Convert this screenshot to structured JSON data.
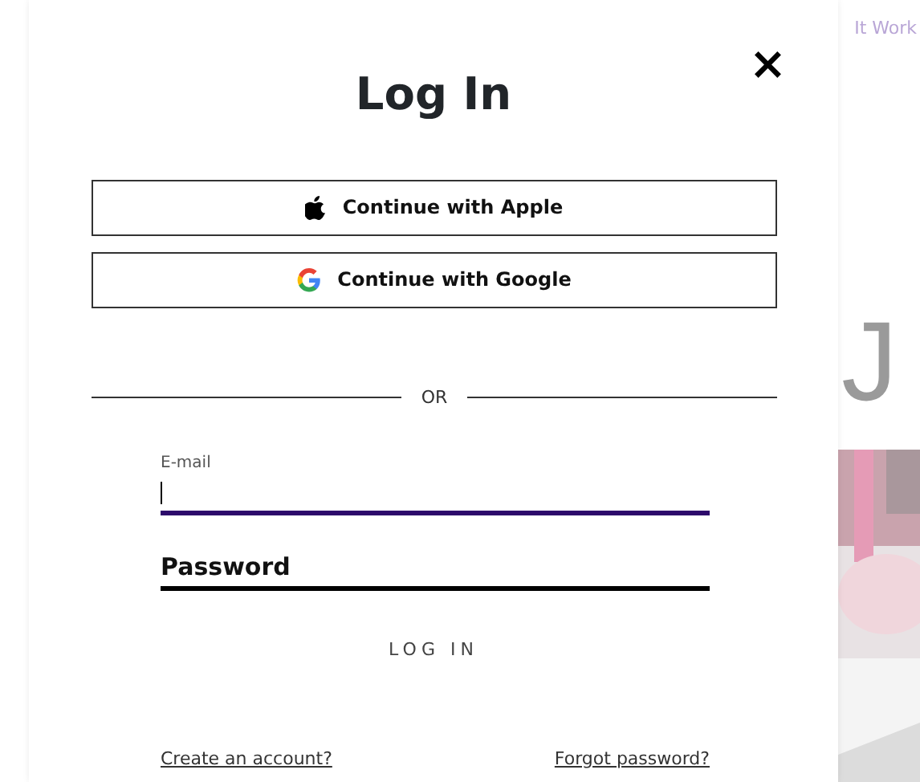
{
  "background": {
    "nav_text": "It Work",
    "heading_letter": "J"
  },
  "dialog": {
    "title": "Log In",
    "close": "×",
    "social_buttons": [
      {
        "kind": "apple",
        "label": "Continue with Apple"
      },
      {
        "kind": "google",
        "label": "Continue with Google"
      }
    ],
    "divider": "OR",
    "email": {
      "label": "E-mail",
      "focused": true
    },
    "password": {
      "placeholder": "Password",
      "focused": false
    },
    "submit": "LOG IN",
    "links": [
      "Create an account?",
      "Forgot password?"
    ]
  }
}
